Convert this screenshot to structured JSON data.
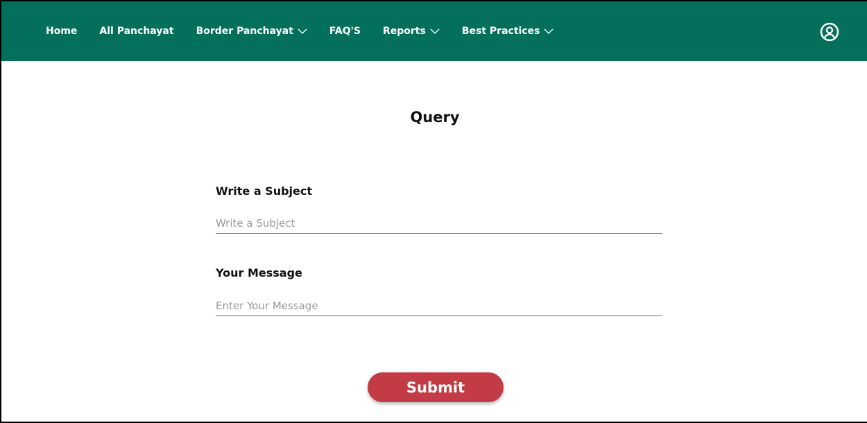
{
  "navbar": {
    "items": [
      {
        "label": "Home",
        "has_dropdown": false
      },
      {
        "label": "All Panchayat",
        "has_dropdown": false
      },
      {
        "label": "Border Panchayat",
        "has_dropdown": true
      },
      {
        "label": "FAQ'S",
        "has_dropdown": false
      },
      {
        "label": "Reports",
        "has_dropdown": true
      },
      {
        "label": "Best Practices",
        "has_dropdown": true
      }
    ],
    "user_icon": "user-circle-icon"
  },
  "form": {
    "title": "Query",
    "subject": {
      "label": "Write a Subject",
      "placeholder": "Write a Subject",
      "value": ""
    },
    "message": {
      "label": "Your Message",
      "placeholder": "Enter Your Message",
      "value": ""
    },
    "submit_label": "Submit"
  },
  "colors": {
    "navbar_bg": "#04705C",
    "submit_bg": "#C33C45",
    "nav_text": "#FFFFFF"
  }
}
